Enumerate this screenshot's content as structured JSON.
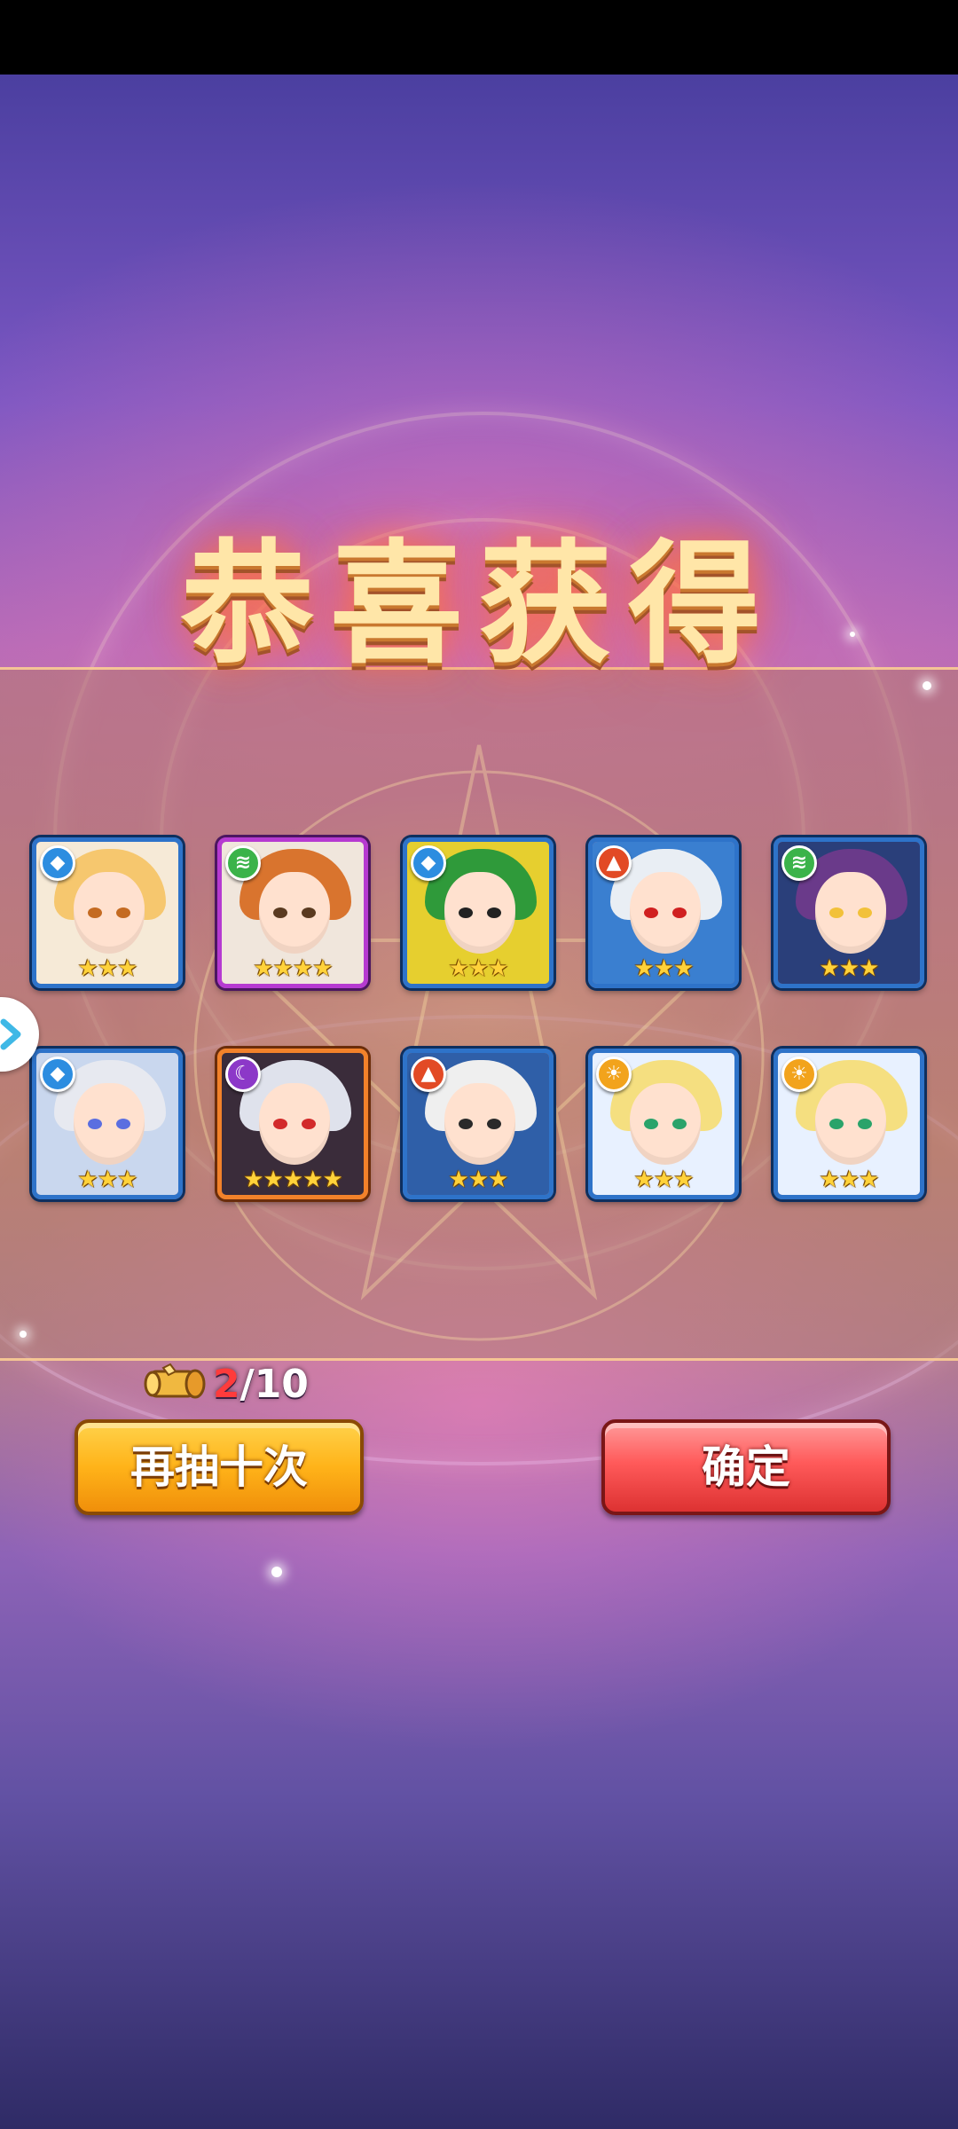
{
  "title": "恭喜获得",
  "heroes": [
    {
      "element": "water",
      "element_icon": "water-drop-icon",
      "stars": "★★★",
      "frame": "blue",
      "hair": "#f6c76e",
      "eye": "#c46b22",
      "bg": "#f6ead7"
    },
    {
      "element": "wind",
      "element_icon": "wind-icon",
      "stars": "★★★★",
      "frame": "purple",
      "hair": "#d9742e",
      "eye": "#5a3a20",
      "bg": "#f0e6dc"
    },
    {
      "element": "water",
      "element_icon": "water-drop-icon",
      "stars": "★★★",
      "frame": "blue",
      "hair": "#2f9a3a",
      "eye": "#222222",
      "bg": "#e6cf2f"
    },
    {
      "element": "fire",
      "element_icon": "fire-icon",
      "stars": "★★★",
      "frame": "blue",
      "hair": "#e9eef4",
      "eye": "#d02020",
      "bg": "#3a7fd0"
    },
    {
      "element": "wind",
      "element_icon": "wind-icon",
      "stars": "★★★",
      "frame": "blue",
      "hair": "#6a3a8a",
      "eye": "#f2c13a",
      "bg": "#2a3f7a"
    },
    {
      "element": "water",
      "element_icon": "water-drop-icon",
      "stars": "★★★",
      "frame": "blue",
      "hair": "#e7e9f0",
      "eye": "#5b6ee0",
      "bg": "#c9d7ee"
    },
    {
      "element": "dark",
      "element_icon": "moon-icon",
      "stars": "★★★★★",
      "frame": "orange",
      "hair": "#dfe2ec",
      "eye": "#d22a2a",
      "bg": "#3a2c3a"
    },
    {
      "element": "fire",
      "element_icon": "fire-icon",
      "stars": "★★★",
      "frame": "blue",
      "hair": "#efefef",
      "eye": "#2a2a2a",
      "bg": "#2f5fa8"
    },
    {
      "element": "light",
      "element_icon": "sun-icon",
      "stars": "★★★",
      "frame": "blue",
      "hair": "#f5df80",
      "eye": "#2aa36a",
      "bg": "#e8f1ff"
    },
    {
      "element": "light",
      "element_icon": "sun-icon",
      "stars": "★★★",
      "frame": "blue",
      "hair": "#f5df80",
      "eye": "#2aa36a",
      "bg": "#e8f1ff"
    }
  ],
  "ticket": {
    "icon": "scroll-ticket-icon",
    "current": "2",
    "total": "/10"
  },
  "buttons": {
    "draw_again": "再抽十次",
    "confirm": "确定"
  },
  "colors": {
    "water": "#2c8de0",
    "wind": "#3bb34a",
    "fire": "#e24a25",
    "dark": "#8c38c8",
    "light": "#f2a31c",
    "frame_blue": "#2e73c9",
    "frame_purple": "#b63ad1",
    "frame_orange": "#f2822a"
  }
}
